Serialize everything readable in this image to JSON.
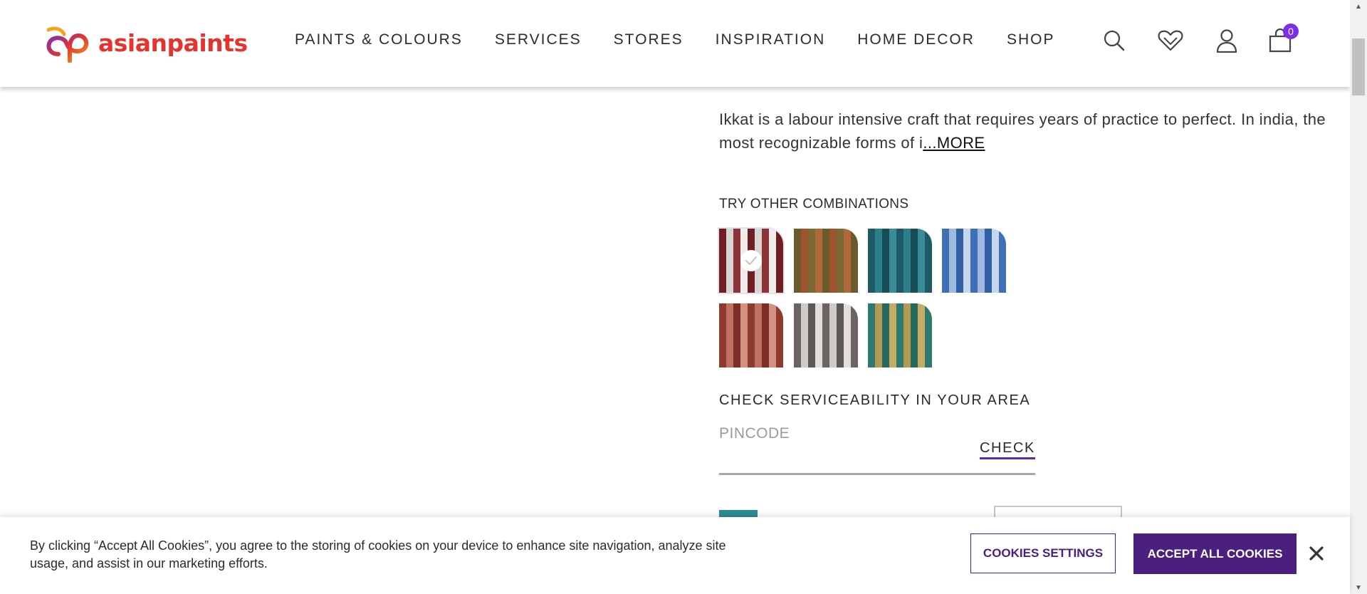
{
  "header": {
    "logo_text": "asianpaints",
    "nav": [
      {
        "label": "PAINTS & COLOURS"
      },
      {
        "label": "SERVICES"
      },
      {
        "label": "STORES"
      },
      {
        "label": "INSPIRATION"
      },
      {
        "label": "HOME DECOR"
      },
      {
        "label": "SHOP"
      }
    ],
    "icons": [
      "search-icon",
      "wishlist-heart-icon",
      "user-account-icon",
      "cart-bag-icon"
    ],
    "cart_count": "0"
  },
  "product": {
    "description": "Ikkat is a labour intensive craft that requires years of practice to perfect. In india, the most recognizable forms of i",
    "more_label": "...MORE"
  },
  "combinations": {
    "title": "TRY OTHER COMBINATIONS",
    "swatches": [
      {
        "name": "maroon-white-stripes",
        "colors": [
          "#6e1f22",
          "#d9d3d2",
          "#8b3437",
          "#f1eceb"
        ],
        "selected": true
      },
      {
        "name": "olive-rust-stripes",
        "colors": [
          "#6a5a2c",
          "#a0522d",
          "#7a6a35",
          "#b0683a"
        ],
        "selected": false
      },
      {
        "name": "teal-stripes",
        "colors": [
          "#1d5a66",
          "#2b7f8a",
          "#174b55",
          "#3a8d96"
        ],
        "selected": false
      },
      {
        "name": "blue-stripes",
        "colors": [
          "#3f6fb6",
          "#9fb9de",
          "#2f5fa6",
          "#c5d6ec"
        ],
        "selected": false
      },
      {
        "name": "rust-red-stripes",
        "colors": [
          "#8e3a2e",
          "#c07060",
          "#7a2f26",
          "#d49080"
        ],
        "selected": false
      },
      {
        "name": "grey-stripes",
        "colors": [
          "#6b6463",
          "#cfcbc9",
          "#5e5756",
          "#e2dfde"
        ],
        "selected": false
      },
      {
        "name": "teal-mustard-stripes",
        "colors": [
          "#2e7a6e",
          "#b49a55",
          "#256a60",
          "#c7ab65"
        ],
        "selected": false
      }
    ]
  },
  "serviceability": {
    "title": "CHECK SERVICEABILITY IN YOUR AREA",
    "pincode_placeholder": "PINCODE",
    "pincode_value": "",
    "check_label": "CHECK"
  },
  "cookie_banner": {
    "text": "By clicking “Accept All Cookies”, you agree to the storing of cookies on your device to enhance site navigation, analyze site usage, and assist in our marketing efforts.",
    "settings_label": "COOKIES SETTINGS",
    "accept_label": "ACCEPT ALL COOKIES"
  },
  "colors": {
    "brand_red": "#e4342d",
    "brand_purple": "#4b1f80",
    "badge_purple": "#7d2ee8",
    "check_underline": "#5a2ca8"
  }
}
